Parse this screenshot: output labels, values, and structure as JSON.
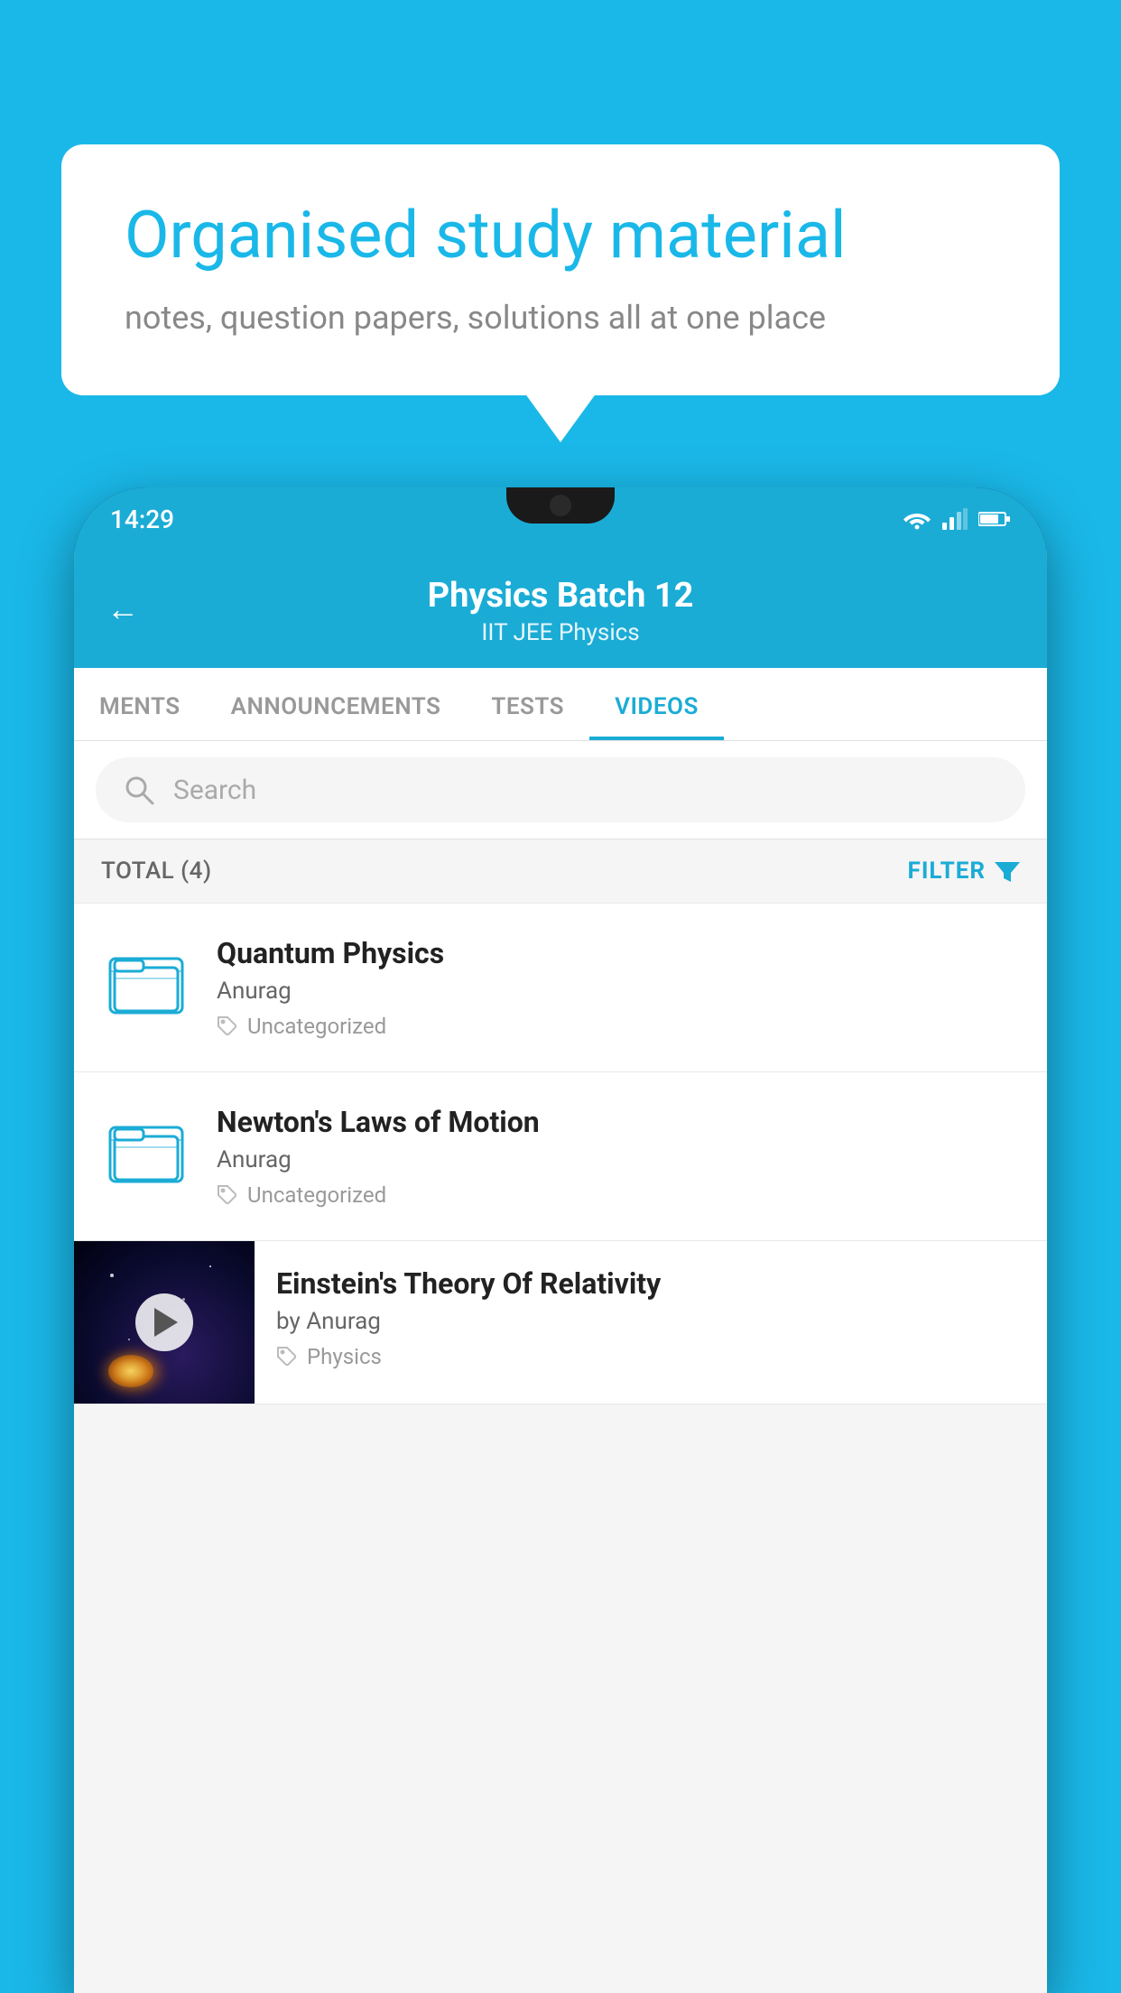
{
  "background": {
    "color": "#1ab8e8"
  },
  "speech_bubble": {
    "headline": "Organised study material",
    "subtext": "notes, question papers, solutions all at one place"
  },
  "phone": {
    "status_bar": {
      "time": "14:29"
    },
    "app_header": {
      "back_label": "←",
      "title": "Physics Batch 12",
      "subtitle": "IIT JEE   Physics"
    },
    "tabs": [
      {
        "label": "MENTS",
        "active": false
      },
      {
        "label": "ANNOUNCEMENTS",
        "active": false
      },
      {
        "label": "TESTS",
        "active": false
      },
      {
        "label": "VIDEOS",
        "active": true
      }
    ],
    "search": {
      "placeholder": "Search"
    },
    "filter_bar": {
      "total_label": "TOTAL (4)",
      "filter_label": "FILTER"
    },
    "videos": [
      {
        "title": "Quantum Physics",
        "author": "Anurag",
        "tag": "Uncategorized",
        "has_thumbnail": false
      },
      {
        "title": "Newton's Laws of Motion",
        "author": "Anurag",
        "tag": "Uncategorized",
        "has_thumbnail": false
      },
      {
        "title": "Einstein's Theory Of Relativity",
        "author": "by Anurag",
        "tag": "Physics",
        "has_thumbnail": true
      }
    ]
  }
}
